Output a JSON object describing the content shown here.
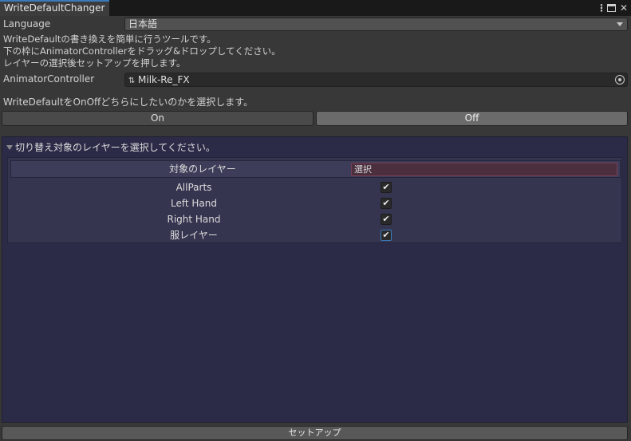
{
  "window": {
    "title": "WriteDefaultChanger"
  },
  "language": {
    "label": "Language",
    "value": "日本語"
  },
  "description": [
    "WriteDefaultの書き換えを簡単に行うツールです。",
    "下の枠にAnimatorControllerをドラッグ&ドロップしてください。",
    "レイヤーの選択後セットアップを押します。"
  ],
  "animator": {
    "label": "AnimatorController",
    "value": "Milk-Re_FX"
  },
  "write_default": {
    "prompt": "WriteDefaultをOnOffどちらにしたいのかを選択します。",
    "on_label": "On",
    "off_label": "Off",
    "selected": "Off"
  },
  "layers": {
    "header": "切り替え対象のレイヤーを選択してください。",
    "column_label": "対象のレイヤー",
    "select_label": "選択",
    "items": [
      {
        "name": "AllParts",
        "checked": true
      },
      {
        "name": "Left Hand",
        "checked": true
      },
      {
        "name": "Right Hand",
        "checked": true
      },
      {
        "name": "服レイヤー",
        "checked": true
      }
    ]
  },
  "setup_label": "セットアップ",
  "colors": {
    "accent": "#3a79bb",
    "panel": "#2b2b48",
    "select_field": "#4b2f3f"
  }
}
